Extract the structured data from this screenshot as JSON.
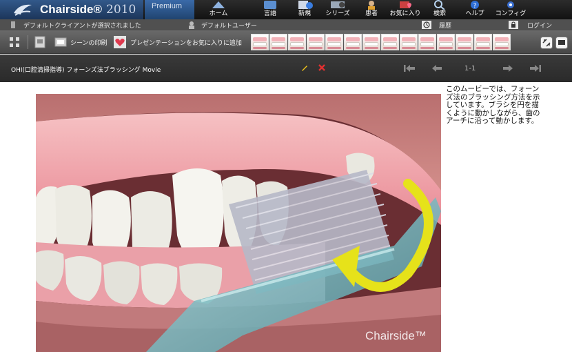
{
  "brand": {
    "name": "Chairside®",
    "year": "2010",
    "edition": "Premium"
  },
  "nav": [
    {
      "label": "ホーム",
      "icon": "home-icon"
    },
    {
      "label": "言語",
      "icon": "language-icon"
    },
    {
      "label": "新規",
      "icon": "new-icon"
    },
    {
      "label": "シリーズ",
      "icon": "series-icon"
    },
    {
      "label": "患者",
      "icon": "patient-icon"
    },
    {
      "label": "お気に入り",
      "icon": "favorites-icon"
    },
    {
      "label": "検索",
      "icon": "search-icon"
    },
    {
      "label": "ヘルプ",
      "icon": "help-icon"
    },
    {
      "label": "コンフィグ",
      "icon": "config-icon"
    }
  ],
  "status": {
    "client": "デフォルトクライアントが選択されました",
    "user": "デフォルトユーザー",
    "history": "履歴",
    "login": "ログイン"
  },
  "toolbar": {
    "print_label": "シーンの印刷",
    "favorite_label": "プレゼンテーションをお気に入りに追加"
  },
  "title": {
    "text": "OHI(口腔清掃指導) フォーンズ法ブラッシング Movie",
    "pager": "1-1"
  },
  "content": {
    "watermark": "Chairside™",
    "description": "このムービーでは、フォーンズ法のブラッシング方法を示しています。ブラシを円を描くように動かしながら、歯のアーチに沿って動かします。"
  },
  "colors": {
    "accent_blue": "#2a4f82",
    "arrow_yellow": "#e6e21a",
    "edit_yellow": "#f0c419",
    "delete_red": "#e03030"
  }
}
